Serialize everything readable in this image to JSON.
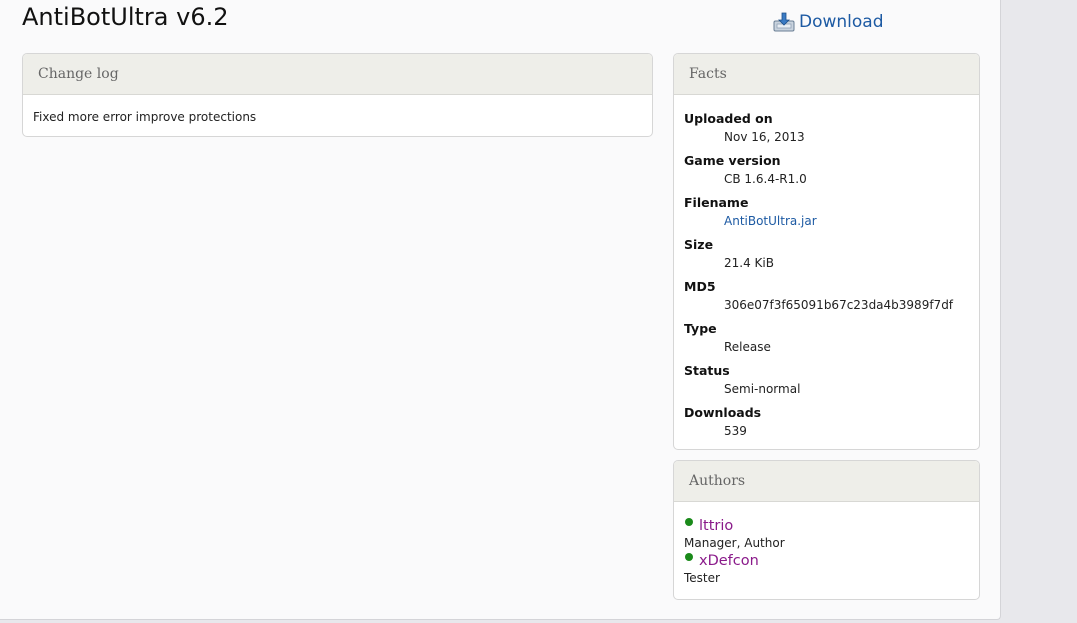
{
  "header": {
    "title": "AntiBotUltra v6.2",
    "download_label": "Download"
  },
  "changelog": {
    "heading": "Change log",
    "text": "Fixed more error improve protections"
  },
  "facts": {
    "heading": "Facts",
    "items": [
      {
        "label": "Uploaded on",
        "value": "Nov 16, 2013"
      },
      {
        "label": "Game version",
        "value": "CB 1.6.4-R1.0"
      },
      {
        "label": "Filename",
        "value": "AntiBotUltra.jar"
      },
      {
        "label": "Size",
        "value": "21.4 KiB"
      },
      {
        "label": "MD5",
        "value": "306e07f3f65091b67c23da4b3989f7df"
      },
      {
        "label": "Type",
        "value": "Release"
      },
      {
        "label": "Status",
        "value": "Semi-normal"
      },
      {
        "label": "Downloads",
        "value": "539"
      }
    ]
  },
  "authors": {
    "heading": "Authors",
    "list": [
      {
        "name": "lttrio",
        "role": "Manager, Author",
        "status_color": "#1a8a1a"
      },
      {
        "name": "xDefcon",
        "role": "Tester",
        "status_color": "#1a8a1a"
      }
    ]
  },
  "colors": {
    "link": "#1d5aa3",
    "author_link": "#8a1a8a",
    "online": "#1a8a1a"
  },
  "icons": {
    "download": "download-box-icon",
    "online": "online-status-icon"
  }
}
